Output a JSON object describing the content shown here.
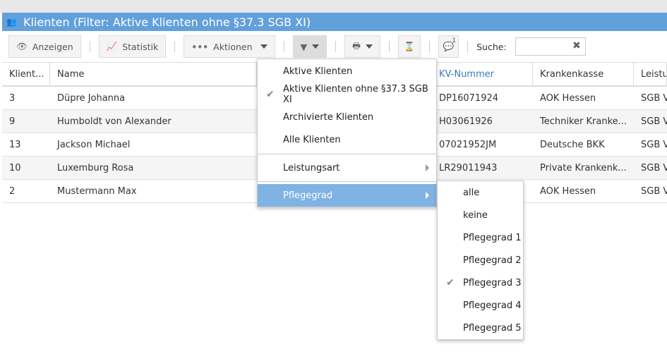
{
  "title": "Klienten (Filter: Aktive Klienten ohne §37.3 SGB XI)",
  "toolbar": {
    "anzeigen": "Anzeigen",
    "statistik": "Statistik",
    "aktionen": "Aktionen",
    "notification_count": "1",
    "search_label": "Suche:",
    "search_value": ""
  },
  "table": {
    "headers": [
      "Klient...",
      "Name",
      "",
      "KV-Nummer",
      "Krankenkasse",
      "Leistu"
    ],
    "rows": [
      [
        "3",
        "Düpre Johanna",
        "",
        "DP16071924",
        "AOK Hessen",
        "SGB V"
      ],
      [
        "9",
        "Humboldt von Alexander",
        "",
        "H03061926",
        "Techniker Kranke...",
        "SGB V"
      ],
      [
        "13",
        "Jackson Michael",
        "",
        "07021952JM",
        "Deutsche BKK",
        "SGB V"
      ],
      [
        "10",
        "Luxemburg Rosa",
        "",
        "LR29011943",
        "Private Krankenk...",
        "SGB V"
      ],
      [
        "2",
        "Mustermann Max",
        "",
        "",
        "AOK Hessen",
        "SGB V"
      ]
    ]
  },
  "filter_menu": {
    "items": [
      "Aktive Klienten",
      "Aktive Klienten ohne §37.3 SGB XI",
      "Archivierte Klienten",
      "Alle Klienten"
    ],
    "checked": 1,
    "leistungsart": "Leistungsart",
    "pflegegrad": "Pflegegrad"
  },
  "pflegegrad_menu": {
    "items": [
      "alle",
      "keine",
      "Pflegegrad 1",
      "Pflegegrad 2",
      "Pflegegrad 3",
      "Pflegegrad 4",
      "Pflegegrad 5"
    ],
    "checked": 4
  },
  "colors": {
    "title_bar": "#62a0dc",
    "highlight": "#7fb3e3"
  }
}
